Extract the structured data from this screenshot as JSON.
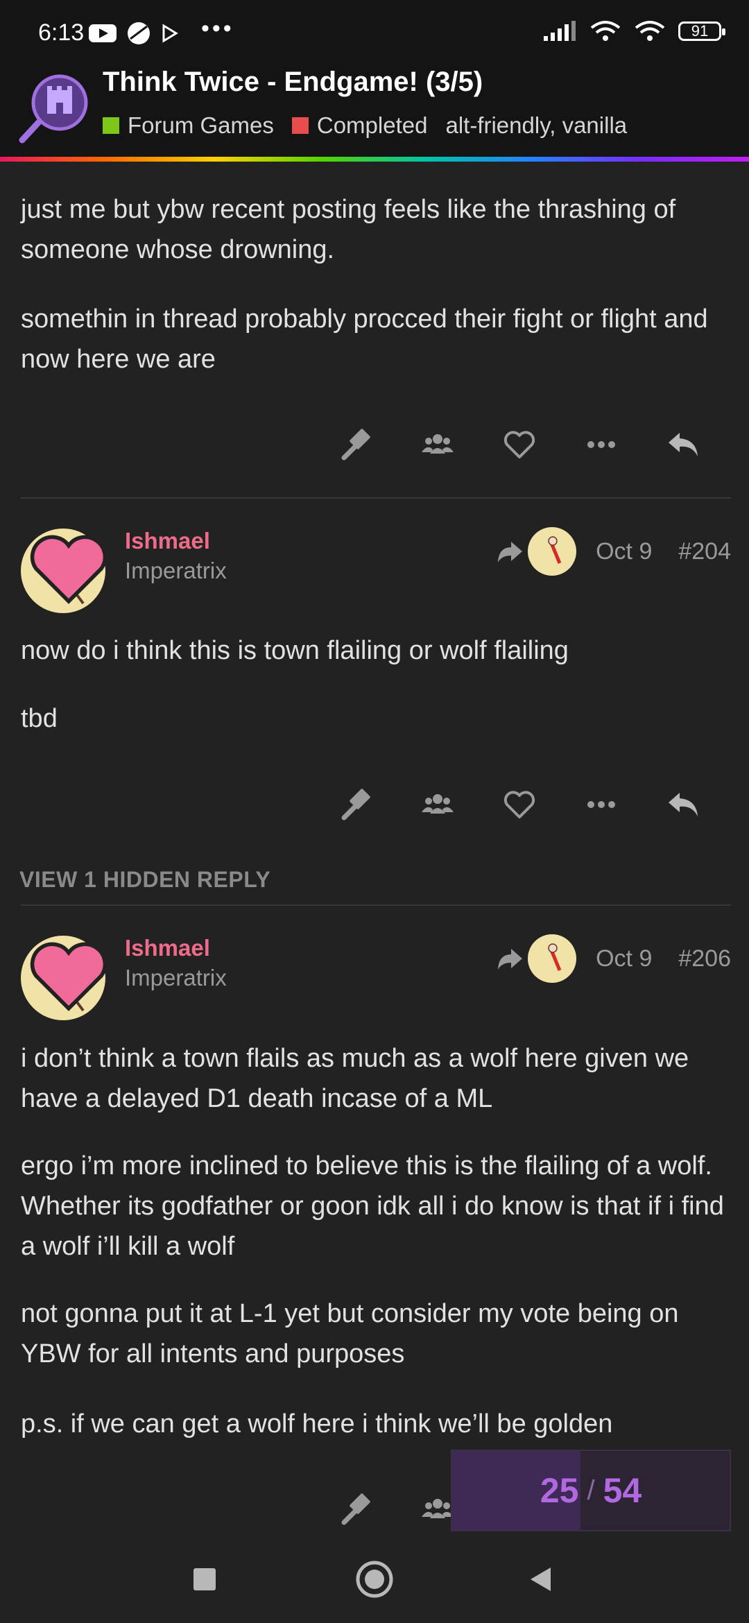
{
  "status_bar": {
    "time": "6:13",
    "battery": "91"
  },
  "topic": {
    "title": "Think Twice - Endgame! (3/5)",
    "category": "Forum Games",
    "status": "Completed",
    "tags": "alt-friendly, vanilla",
    "colors": {
      "category": "#7ec61c",
      "status": "#e84c4c"
    }
  },
  "post_prev": {
    "paragraphs": [
      "just me but ybw recent posting feels like the thrashing of someone whose drowning.",
      "somethin in thread probably procced their fight or flight and now here we are"
    ]
  },
  "post_204": {
    "username": "Ishmael",
    "user_title": "Imperatrix",
    "date": "Oct 9",
    "number": "#204",
    "paragraphs": [
      "now do i think this is town flailing or wolf flailing",
      "tbd"
    ]
  },
  "hidden_reply": "VIEW 1 HIDDEN REPLY",
  "post_206": {
    "username": "Ishmael",
    "user_title": "Imperatrix",
    "date": "Oct 9",
    "number": "#206",
    "paragraphs": [
      "i don’t think a town flails as much as a wolf here given we have a delayed D1 death incase of a ML",
      "ergo i’m more inclined to believe this is the flailing of a wolf. Whether its godfather or goon idk all i do know is that if i find a wolf i’ll kill a wolf",
      "not gonna put it at L-1 yet but consider my vote being on YBW for all intents and purposes",
      "p.s. if we can get a wolf here i think we’ll be golden"
    ]
  },
  "progress": {
    "current": "25",
    "total": "54",
    "fraction": 0.463
  },
  "icons": [
    "gavel-icon",
    "users-icon",
    "heart-icon",
    "more-icon",
    "reply-icon",
    "share-icon"
  ],
  "accent": "#ee6c8a"
}
